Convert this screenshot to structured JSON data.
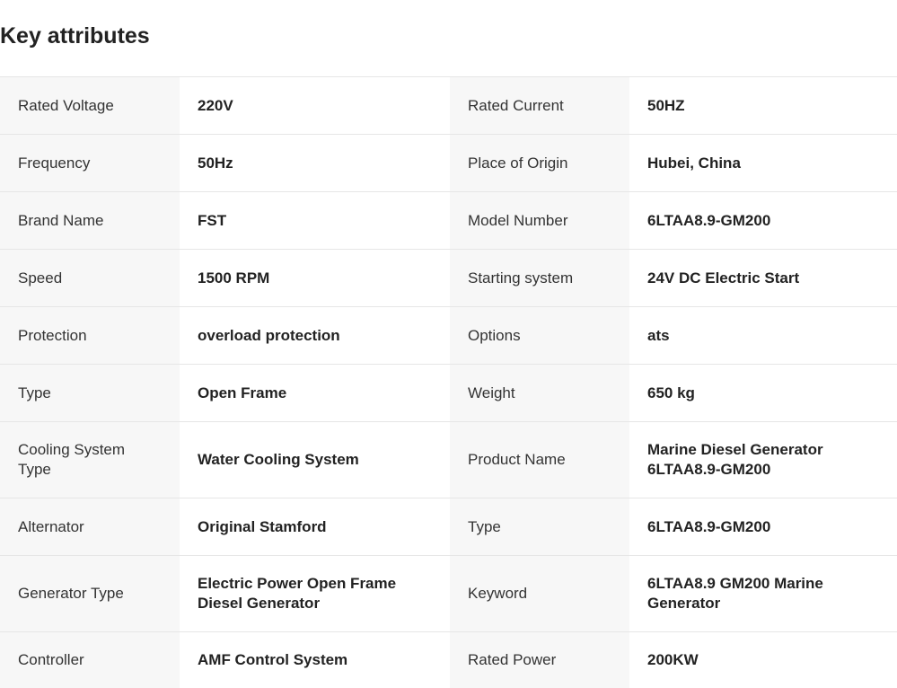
{
  "section": {
    "title": "Key attributes"
  },
  "rows": [
    {
      "l1": "Rated Voltage",
      "v1": "220V",
      "l2": "Rated Current",
      "v2": "50HZ"
    },
    {
      "l1": "Frequency",
      "v1": "50Hz",
      "l2": "Place of Origin",
      "v2": "Hubei, China"
    },
    {
      "l1": "Brand Name",
      "v1": "FST",
      "l2": "Model Number",
      "v2": "6LTAA8.9-GM200"
    },
    {
      "l1": "Speed",
      "v1": "1500 RPM",
      "l2": "Starting system",
      "v2": "24V DC Electric Start"
    },
    {
      "l1": "Protection",
      "v1": "overload protection",
      "l2": "Options",
      "v2": "ats"
    },
    {
      "l1": "Type",
      "v1": "Open Frame",
      "l2": "Weight",
      "v2": "650 kg"
    },
    {
      "l1": "Cooling System Type",
      "v1": "Water Cooling System",
      "l2": "Product Name",
      "v2": "Marine Diesel Generator 6LTAA8.9-GM200"
    },
    {
      "l1": "Alternator",
      "v1": "Original Stamford",
      "l2": "Type",
      "v2": "6LTAA8.9-GM200"
    },
    {
      "l1": "Generator Type",
      "v1": "Electric Power Open Frame Diesel Generator",
      "l2": "Keyword",
      "v2": "6LTAA8.9 GM200 Marine Generator"
    },
    {
      "l1": "Controller",
      "v1": "AMF Control System",
      "l2": "Rated Power",
      "v2": "200KW"
    }
  ]
}
